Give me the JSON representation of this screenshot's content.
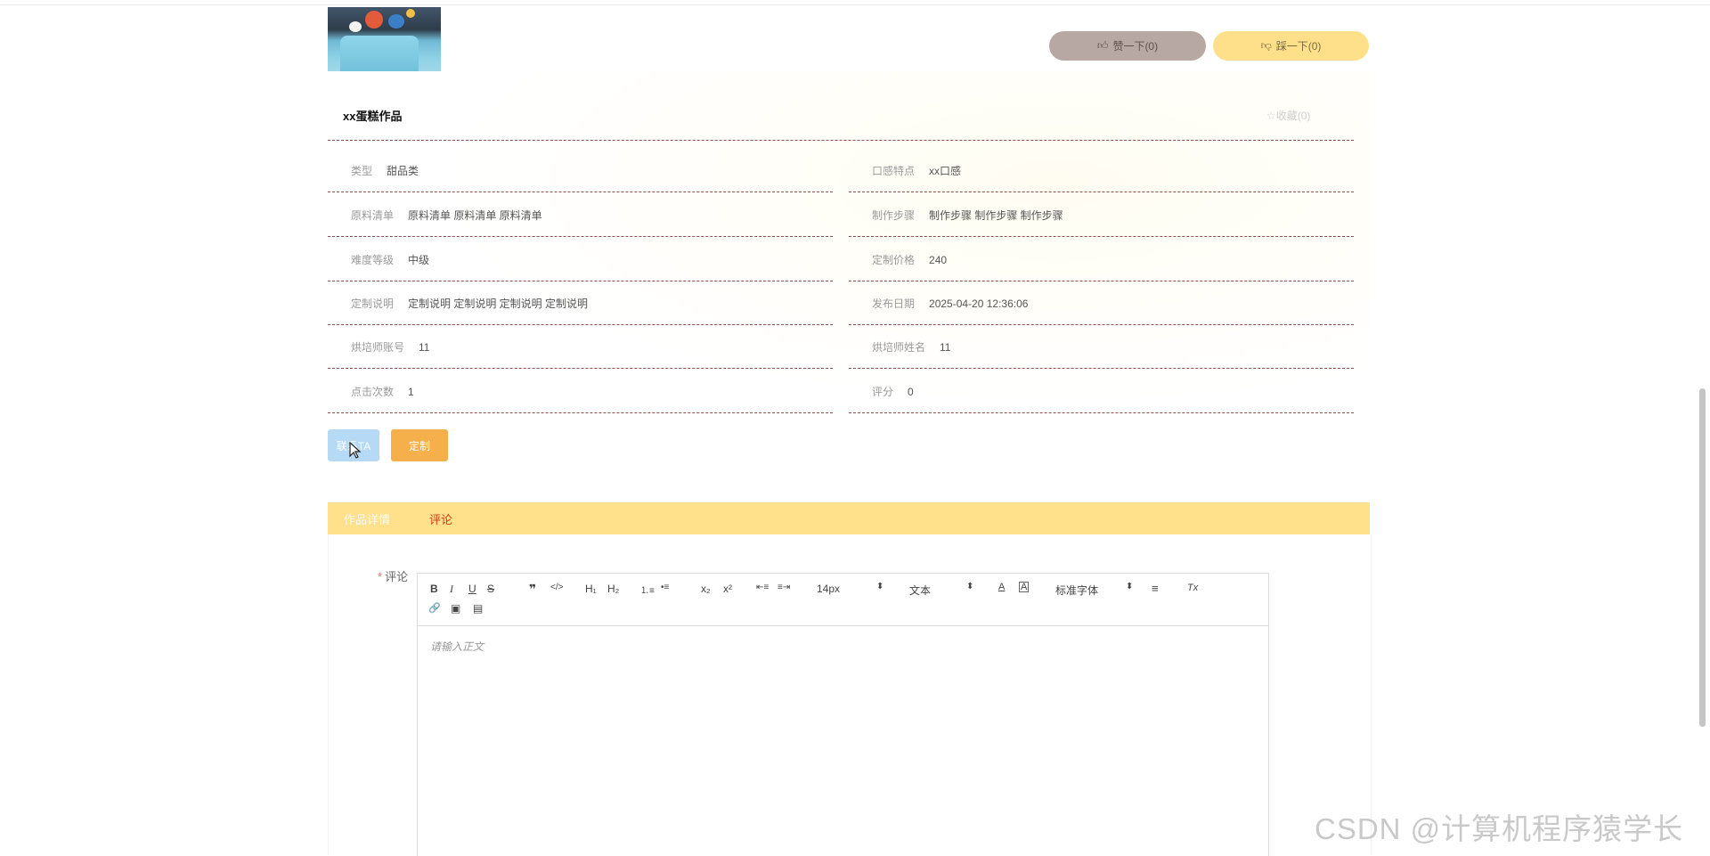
{
  "product": {
    "title": "xx蛋糕作品",
    "favorite_label": "☆收藏(0)",
    "like_label": "赞一下(0)",
    "dislike_label": "踩一下(0)"
  },
  "details": [
    {
      "label": "类型",
      "value": "甜品类"
    },
    {
      "label": "口感特点",
      "value": "xx口感"
    },
    {
      "label": "原料清单",
      "value": "原料清单 原料清单 原料清单"
    },
    {
      "label": "制作步骤",
      "value": "制作步骤 制作步骤 制作步骤"
    },
    {
      "label": "难度等级",
      "value": "中级"
    },
    {
      "label": "定制价格",
      "value": "240"
    },
    {
      "label": "定制说明",
      "value": "定制说明 定制说明 定制说明 定制说明"
    },
    {
      "label": "发布日期",
      "value": "2025-04-20 12:36:06"
    },
    {
      "label": "烘培师账号",
      "value": "11"
    },
    {
      "label": "烘培师姓名",
      "value": "11"
    },
    {
      "label": "点击次数",
      "value": "1"
    },
    {
      "label": "评分",
      "value": "0"
    }
  ],
  "actions": {
    "contact_label": "联系TA",
    "custom_label": "定制"
  },
  "tabs": [
    {
      "label": "作品详情"
    },
    {
      "label": "评论"
    }
  ],
  "comment_form": {
    "required_mark": "*",
    "label": "评论",
    "placeholder": "请输入正文",
    "toolbar": {
      "bold": "B",
      "italic": "I",
      "underline": "U",
      "strike": "S",
      "quote": "❞",
      "code": "</>",
      "h1": "H₁",
      "h2": "H₂",
      "ordered_list": "⒈≡",
      "bullet_list": "•≡",
      "subscript": "x₂",
      "superscript": "x²",
      "outdent": "⇤≡",
      "indent": "≡⇥",
      "size_value": "14px",
      "header_value": "文本",
      "font_color": "A",
      "bg_color": "A",
      "font_value": "标准字体",
      "align": "≡",
      "clean": "Tx",
      "link": "🔗",
      "image": "▣",
      "video": "▤",
      "select_arrow": "⬍"
    }
  },
  "watermark": "CSDN @计算机程序猿学长",
  "icons": {
    "like": "thumbs-up-icon",
    "dislike": "thumbs-down-icon",
    "cursor": "mouse-pointer-icon"
  },
  "colors": {
    "tab_bar": "#ffe18b",
    "active_tab": "#d23a1a",
    "like_button": "#b8a8a4",
    "dislike_button": "#ffe08a",
    "contact_button": "#b6d9f6",
    "custom_button": "#f5b04b"
  }
}
